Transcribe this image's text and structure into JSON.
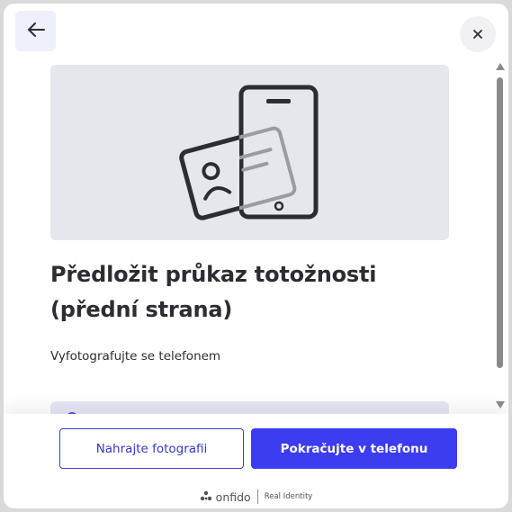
{
  "header": {
    "back_icon": "arrow-left-icon",
    "close_icon": "close-icon"
  },
  "hero": {
    "illustration": "phone-with-id-card-illustration"
  },
  "content": {
    "title": "Předložit průkaz totožnosti (přední strana)",
    "subtitle": "Vyfotografujte se telefonem"
  },
  "actions": {
    "upload_label": "Nahrajte fotografii",
    "continue_label": "Pokračujte v telefonu"
  },
  "branding": {
    "brand": "onfido",
    "tagline": "Real Identity"
  },
  "colors": {
    "primary": "#3c3cf0",
    "hero_bg": "#e5e7ed",
    "text": "#2b2d33",
    "back_bg": "#eef0fb"
  }
}
